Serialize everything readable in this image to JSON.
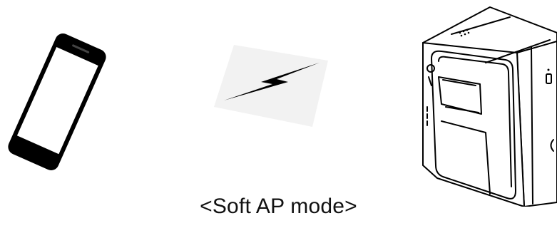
{
  "caption": "<Soft AP mode>",
  "icons": {
    "phone": "smartphone-icon",
    "link": "wireless-bolt-icon",
    "printer": "receipt-printer-icon"
  },
  "colors": {
    "line": "#000000",
    "background": "#ffffff",
    "bolt_backdrop": "#f2f2f2"
  }
}
